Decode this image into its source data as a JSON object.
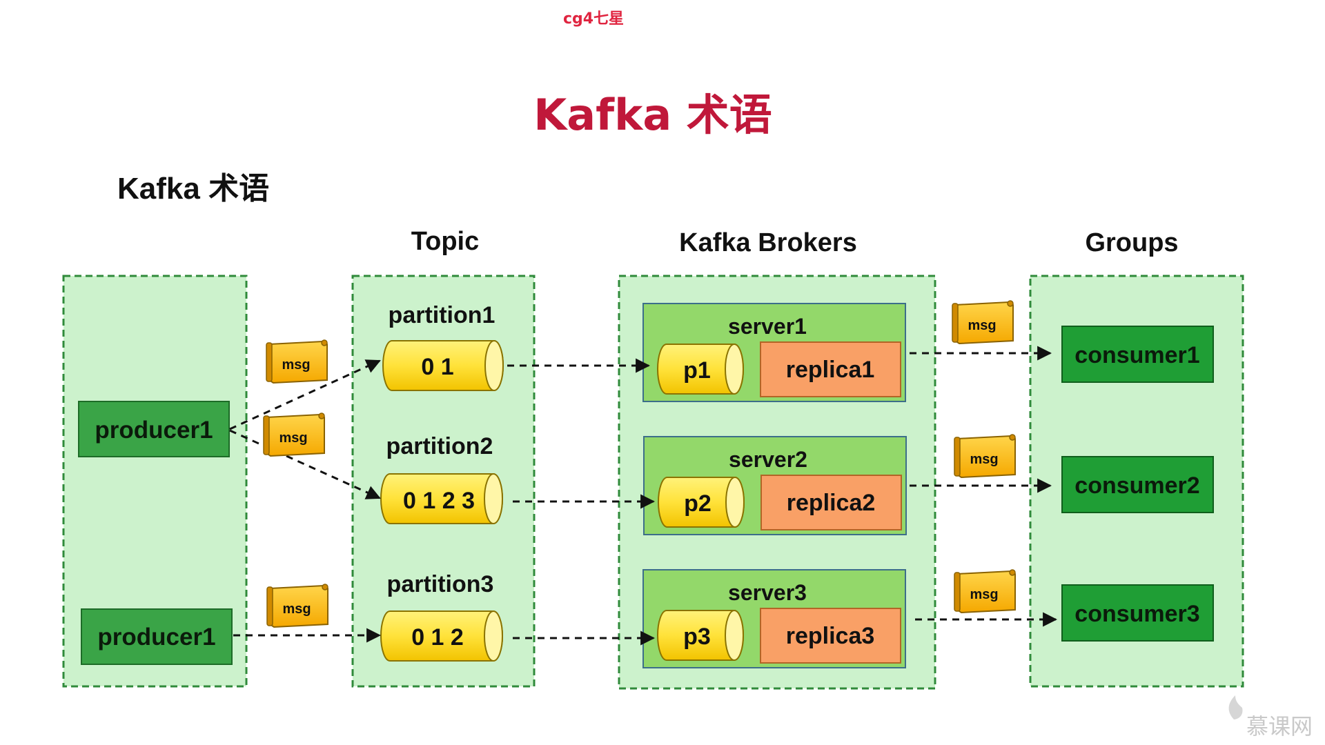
{
  "watermark_top": "cg4七星",
  "main_title": "Kafka 术语",
  "subtitle": "Kafka 术语",
  "headers": {
    "topic": "Topic",
    "brokers": "Kafka Brokers",
    "groups": "Groups"
  },
  "producers": [
    {
      "label": "producer1"
    },
    {
      "label": "producer1"
    }
  ],
  "partitions": [
    {
      "name": "partition1",
      "offsets": "0 1"
    },
    {
      "name": "partition2",
      "offsets": "0 1 2 3"
    },
    {
      "name": "partition3",
      "offsets": "0 1 2"
    }
  ],
  "servers": [
    {
      "name": "server1",
      "partition": "p1",
      "replica": "replica1"
    },
    {
      "name": "server2",
      "partition": "p2",
      "replica": "replica2"
    },
    {
      "name": "server3",
      "partition": "p3",
      "replica": "replica3"
    }
  ],
  "consumers": [
    {
      "label": "consumer1"
    },
    {
      "label": "consumer2"
    },
    {
      "label": "consumer3"
    }
  ],
  "msg_label": "msg",
  "brand": "慕课网",
  "colors": {
    "title_red": "#c0183a",
    "area_fill": "#ccf2cc",
    "area_border": "#2f8a3a",
    "producer_fill": "#3aa447",
    "consumer_fill": "#1f9e35",
    "server_fill": "#93d86a",
    "cylinder_fill": "#ffe23a",
    "replica_fill": "#f9a066",
    "msg_fill": "#ffc400"
  }
}
